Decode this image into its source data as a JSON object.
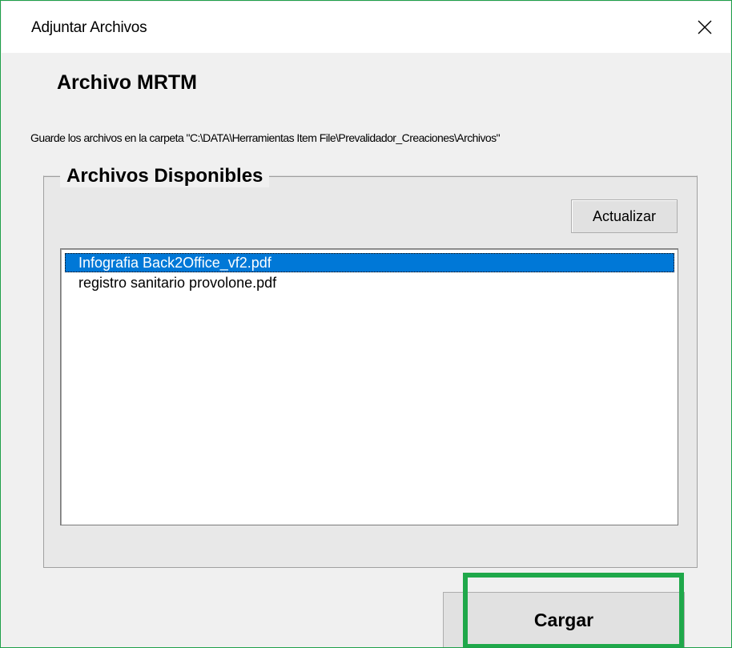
{
  "window": {
    "title": "Adjuntar Archivos",
    "close_glyph": "close-icon"
  },
  "form": {
    "heading": "Archivo MRTM",
    "instructions": "Guarde los archivos en la carpeta \"C:\\DATA\\Herramientas Item File\\Prevalidador_Creaciones\\Archivos\""
  },
  "group": {
    "legend": "Archivos Disponibles",
    "refresh_label": "Actualizar",
    "files": [
      {
        "name": "Infografia Back2Office_vf2.pdf",
        "selected": true
      },
      {
        "name": "registro sanitario provolone.pdf",
        "selected": false
      }
    ]
  },
  "actions": {
    "upload_label": "Cargar"
  },
  "colors": {
    "accent_border": "#1fa84a",
    "selection": "#0078d7"
  }
}
